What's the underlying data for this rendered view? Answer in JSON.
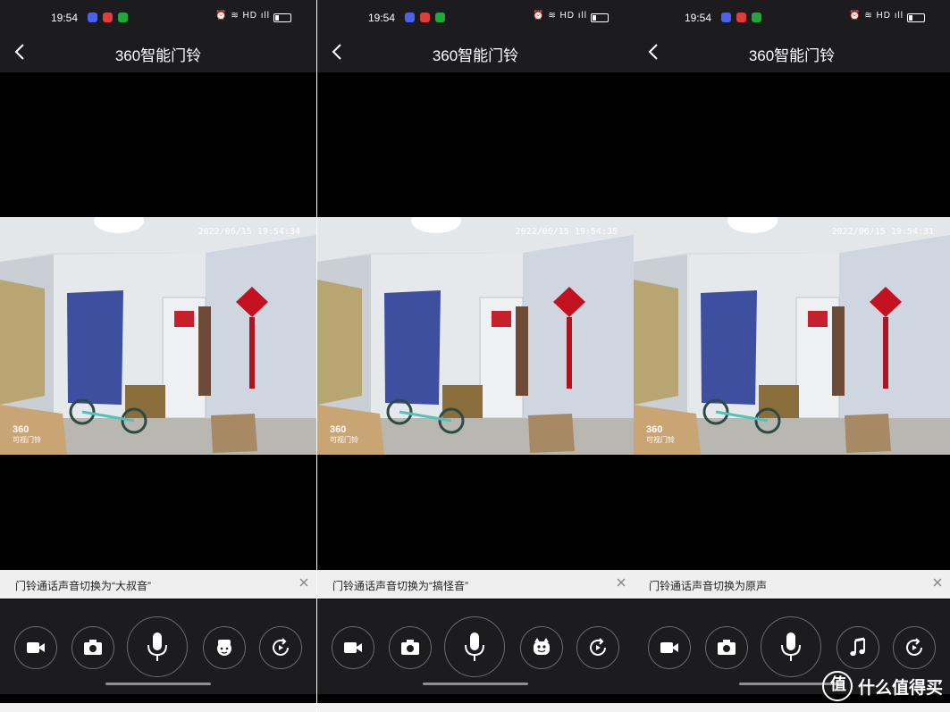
{
  "screens": [
    {
      "time": "19:54",
      "title": "360智能门铃",
      "timestamp": "2022/06/15  19:54:34",
      "watermark": "360",
      "watermark_sub": "可视门铃",
      "toast": "门铃通话声音切换为“大叔音”",
      "controls": [
        "video-record-icon",
        "camera-icon",
        "microphone-icon",
        "uncle-voice-icon",
        "replay-icon"
      ]
    },
    {
      "time": "19:54",
      "title": "360智能门铃",
      "timestamp": "2022/06/15  19:54:35",
      "watermark": "360",
      "watermark_sub": "可视门铃",
      "toast": "门铃通话声音切换为“搞怪音”",
      "controls": [
        "video-record-icon",
        "camera-icon",
        "microphone-icon",
        "funny-voice-icon",
        "replay-icon"
      ]
    },
    {
      "time": "19:54",
      "title": "360智能门铃",
      "timestamp": "2022/06/15  19:54:31",
      "watermark": "360",
      "watermark_sub": "可视门铃",
      "toast": "门铃通话声音切换为原声",
      "controls": [
        "video-record-icon",
        "camera-icon",
        "microphone-icon",
        "music-note-icon",
        "replay-icon"
      ]
    }
  ],
  "brand": {
    "logo_char": "值",
    "text": "什么值得买"
  },
  "colors": {
    "bar_bg": "#1c1c1e",
    "video_bg": "#000000",
    "toast_bg": "#efefef",
    "button_ring": "#6b6b6b"
  }
}
